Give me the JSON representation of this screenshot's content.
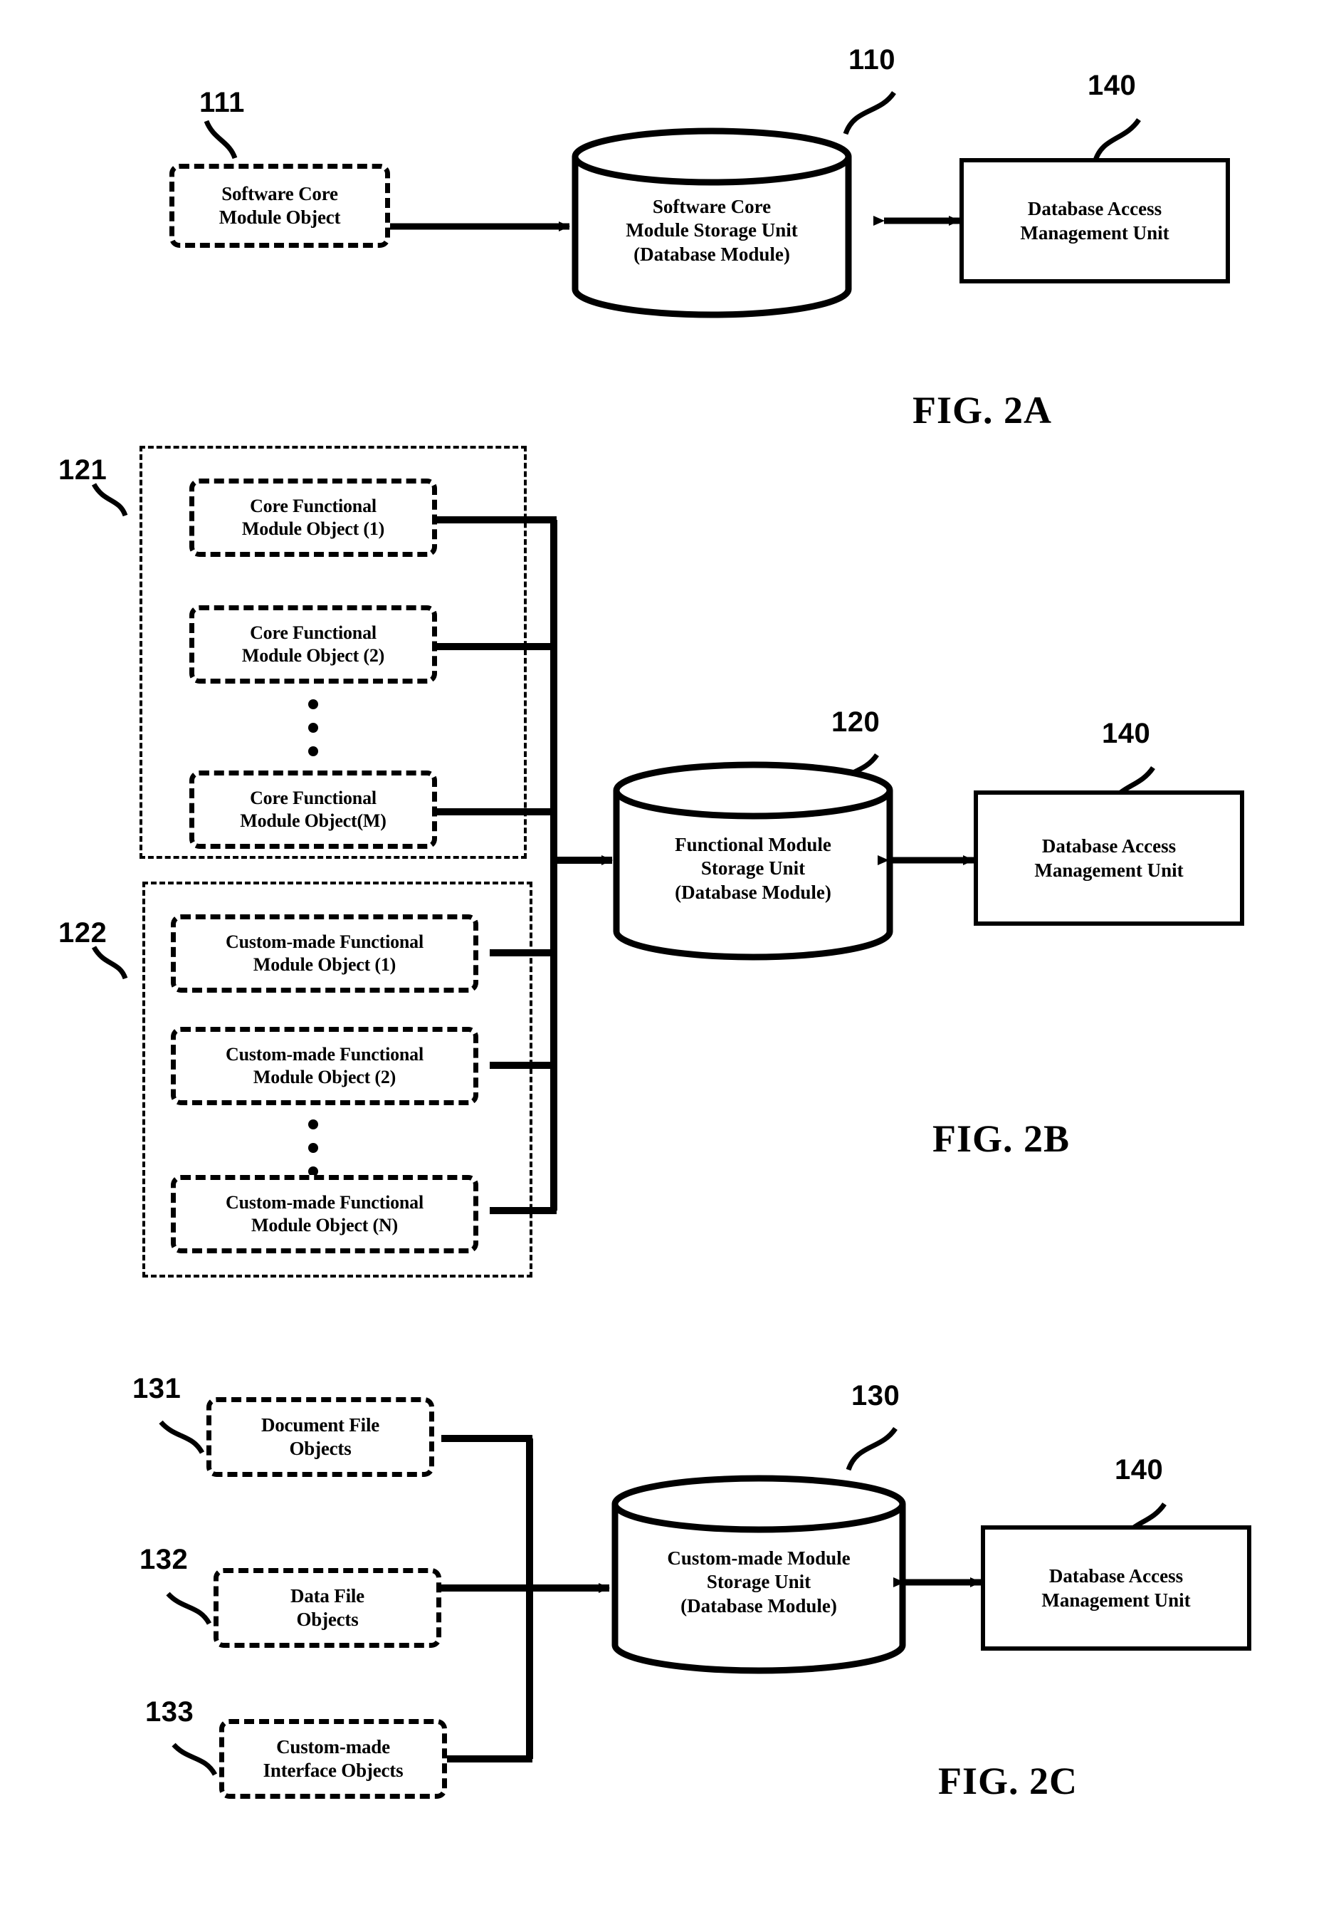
{
  "figure": {
    "title": "Patent drawing sheet — FIG. 2A / FIG. 2B / FIG. 2C",
    "captions": {
      "a": "FIG. 2A",
      "b": "FIG. 2B",
      "c": "FIG. 2C"
    }
  },
  "fig2a": {
    "caption": "FIG. 2A",
    "refs": {
      "object": "111",
      "storage": "110",
      "access": "140"
    },
    "source_object": "Software Core\nModule Object",
    "source_object_lines": [
      "Software Core",
      "Module Object"
    ],
    "storage_unit_lines": [
      "Software Core",
      "Module Storage Unit",
      "(Database Module)"
    ],
    "access_unit_lines": [
      "Database Access",
      "Management Unit"
    ]
  },
  "fig2b": {
    "caption": "FIG. 2B",
    "refs": {
      "core_group": "121",
      "custom_group": "122",
      "storage": "120",
      "access": "140"
    },
    "core_objects": [
      {
        "lines": [
          "Core Functional",
          "Module Object (1)"
        ]
      },
      {
        "lines": [
          "Core Functional",
          "Module Object (2)"
        ]
      },
      {
        "lines": [
          "Core Functional",
          "Module Object(M)"
        ]
      }
    ],
    "custom_objects": [
      {
        "lines": [
          "Custom-made Functional",
          "Module Object (1)"
        ]
      },
      {
        "lines": [
          "Custom-made Functional",
          "Module Object (2)"
        ]
      },
      {
        "lines": [
          "Custom-made Functional",
          "Module Object (N)"
        ]
      }
    ],
    "ellipsis_glyph": "vertical-ellipsis",
    "storage_unit_lines": [
      "Functional Module",
      "Storage Unit",
      "(Database Module)"
    ],
    "access_unit_lines": [
      "Database Access",
      "Management Unit"
    ]
  },
  "fig2c": {
    "caption": "FIG. 2C",
    "refs": {
      "document": "131",
      "data": "132",
      "interface": "133",
      "storage": "130",
      "access": "140"
    },
    "objects": [
      {
        "lines": [
          "Document File",
          "Objects"
        ]
      },
      {
        "lines": [
          "Data File",
          "Objects"
        ]
      },
      {
        "lines": [
          "Custom-made",
          "Interface Objects"
        ]
      }
    ],
    "storage_unit_lines": [
      "Custom-made Module",
      "Storage Unit",
      "(Database Module)"
    ],
    "access_unit_lines": [
      "Database Access",
      "Management Unit"
    ]
  },
  "colors": {
    "ink": "#000000",
    "paper": "#ffffff"
  }
}
